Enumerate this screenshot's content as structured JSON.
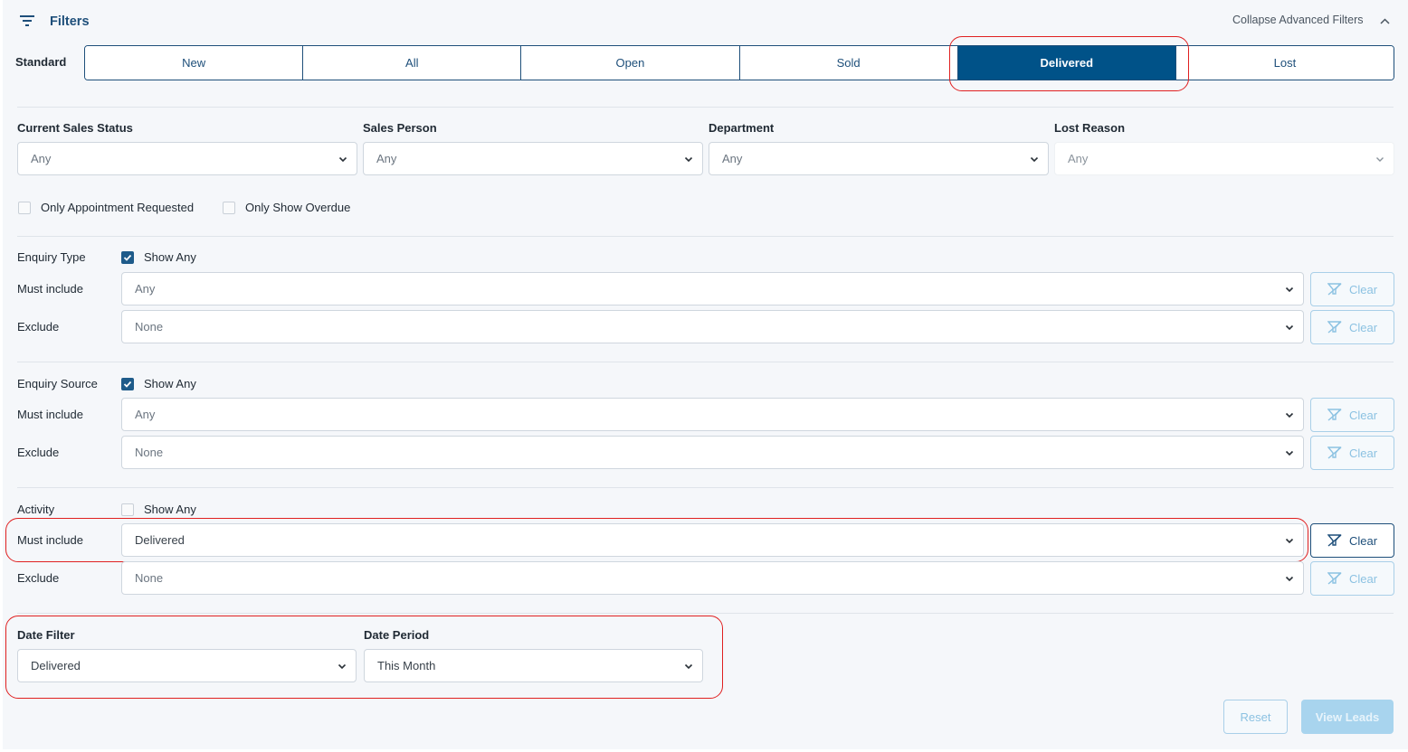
{
  "header": {
    "title": "Filters",
    "collapse_label": "Collapse Advanced Filters"
  },
  "standard": {
    "label": "Standard",
    "tabs": [
      {
        "label": "New",
        "active": false
      },
      {
        "label": "All",
        "active": false
      },
      {
        "label": "Open",
        "active": false
      },
      {
        "label": "Sold",
        "active": false
      },
      {
        "label": "Delivered",
        "active": true
      },
      {
        "label": "Lost",
        "active": false
      }
    ]
  },
  "top_filters": [
    {
      "label": "Current Sales Status",
      "value": "Any"
    },
    {
      "label": "Sales Person",
      "value": "Any"
    },
    {
      "label": "Department",
      "value": "Any"
    },
    {
      "label": "Lost Reason",
      "value": "Any"
    }
  ],
  "checkboxes": [
    {
      "label": "Only Appointment Requested",
      "checked": false
    },
    {
      "label": "Only Show Overdue",
      "checked": false
    }
  ],
  "groups": [
    {
      "title": "Enquiry Type",
      "show_any_label": "Show Any",
      "show_any_checked": true,
      "must_label": "Must include",
      "must_value": "Any",
      "exclude_label": "Exclude",
      "exclude_value": "None"
    },
    {
      "title": "Enquiry Source",
      "show_any_label": "Show Any",
      "show_any_checked": true,
      "must_label": "Must include",
      "must_value": "Any",
      "exclude_label": "Exclude",
      "exclude_value": "None"
    },
    {
      "title": "Activity",
      "show_any_label": "Show Any",
      "show_any_checked": false,
      "must_label": "Must include",
      "must_value": "Delivered",
      "exclude_label": "Exclude",
      "exclude_value": "None"
    }
  ],
  "clear_label": "Clear",
  "date": {
    "filter_label": "Date Filter",
    "filter_value": "Delivered",
    "period_label": "Date Period",
    "period_value": "This Month"
  },
  "actions": {
    "reset": "Reset",
    "view": "View Leads"
  },
  "colors": {
    "primary": "#005288",
    "highlight": "#e02020",
    "disabled": "#a8d4ee"
  }
}
